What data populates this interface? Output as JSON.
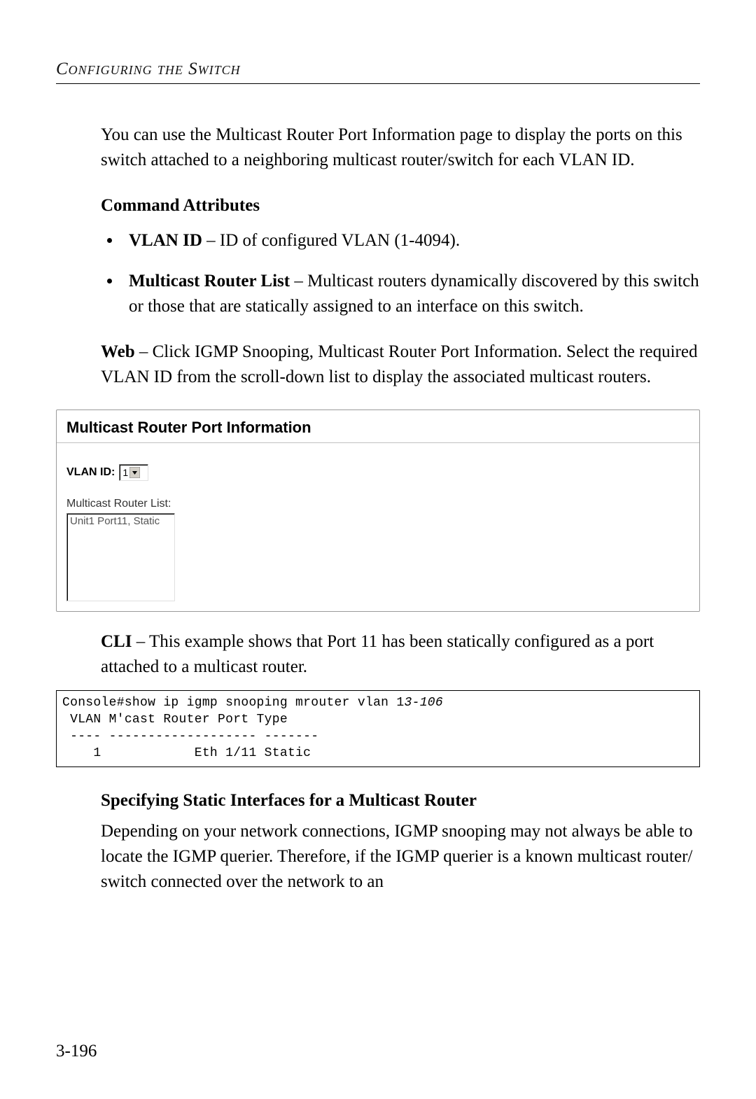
{
  "header": {
    "running_title": "Configuring the Switch"
  },
  "intro": {
    "para1": "You can use the Multicast Router Port Information page to display the ports on this switch attached to a neighboring multicast router/switch for each VLAN ID."
  },
  "command_attributes": {
    "title": "Command Attributes",
    "items": [
      {
        "term": "VLAN ID",
        "desc": " – ID of configured VLAN (1-4094)."
      },
      {
        "term": "Multicast Router List",
        "desc": " – Multicast routers dynamically discovered by this switch or those that are statically assigned to an interface on this switch."
      }
    ]
  },
  "web_note": {
    "term": "Web",
    "desc": " – Click IGMP Snooping, Multicast Router Port Information. Select the required VLAN ID from the scroll-down list to display the associated multicast routers."
  },
  "webui": {
    "panel_title": "Multicast Router Port Information",
    "vlan_label": "VLAN ID:",
    "vlan_value": "1",
    "mrlist_label": "Multicast Router List:",
    "mrlist_item": "Unit1 Port11, Static"
  },
  "cli_note": {
    "term": "CLI",
    "desc": " – This example shows that Port 11 has been statically configured as a port attached to a multicast router."
  },
  "cli": {
    "l1a": "Console#show ip igmp snooping mrouter vlan 1",
    "l1b": "3-106",
    "l2": " VLAN M'cast Router Port Type",
    "l3": " ---- ------------------- -------",
    "l4": "    1            Eth 1/11 Static"
  },
  "section2": {
    "title": "Specifying Static Interfaces for a Multicast Router",
    "para": "Depending on your network connections, IGMP snooping may not always be able to locate the IGMP querier. Therefore, if the IGMP querier is a known multicast router/ switch connected over the network to an"
  },
  "page_number": "3-196"
}
